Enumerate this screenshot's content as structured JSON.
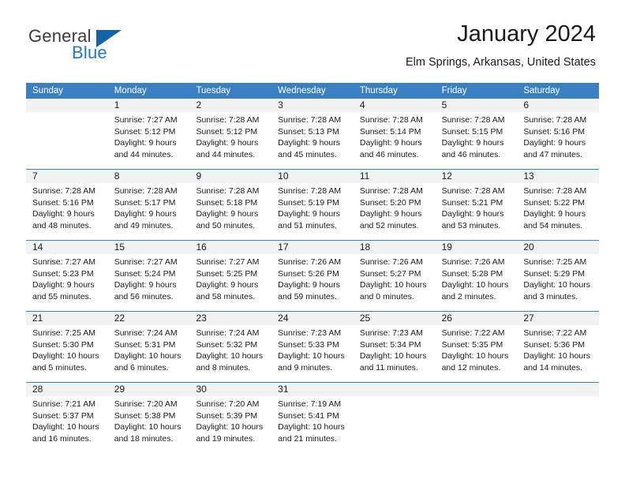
{
  "brand": {
    "name_top": "General",
    "name_bottom": "Blue",
    "color_top": "#3b3b3b",
    "color_bottom": "#1f7ac0",
    "triangle_color": "#1464a5"
  },
  "header": {
    "title": "January 2024",
    "subtitle": "Elm Springs, Arkansas, United States"
  },
  "theme": {
    "header_bg": "#3a80c1",
    "header_text": "#ffffff",
    "daynum_bg": "#f2f2f2",
    "row_divider": "#3a80c1",
    "body_text": "#1a1a1a"
  },
  "weekdays": [
    "Sunday",
    "Monday",
    "Tuesday",
    "Wednesday",
    "Thursday",
    "Friday",
    "Saturday"
  ],
  "weeks": [
    [
      {
        "day": "",
        "lines": [
          "",
          "",
          "",
          ""
        ]
      },
      {
        "day": "1",
        "lines": [
          "Sunrise: 7:27 AM",
          "Sunset: 5:12 PM",
          "Daylight: 9 hours",
          "and 44 minutes."
        ]
      },
      {
        "day": "2",
        "lines": [
          "Sunrise: 7:28 AM",
          "Sunset: 5:12 PM",
          "Daylight: 9 hours",
          "and 44 minutes."
        ]
      },
      {
        "day": "3",
        "lines": [
          "Sunrise: 7:28 AM",
          "Sunset: 5:13 PM",
          "Daylight: 9 hours",
          "and 45 minutes."
        ]
      },
      {
        "day": "4",
        "lines": [
          "Sunrise: 7:28 AM",
          "Sunset: 5:14 PM",
          "Daylight: 9 hours",
          "and 46 minutes."
        ]
      },
      {
        "day": "5",
        "lines": [
          "Sunrise: 7:28 AM",
          "Sunset: 5:15 PM",
          "Daylight: 9 hours",
          "and 46 minutes."
        ]
      },
      {
        "day": "6",
        "lines": [
          "Sunrise: 7:28 AM",
          "Sunset: 5:16 PM",
          "Daylight: 9 hours",
          "and 47 minutes."
        ]
      }
    ],
    [
      {
        "day": "7",
        "lines": [
          "Sunrise: 7:28 AM",
          "Sunset: 5:16 PM",
          "Daylight: 9 hours",
          "and 48 minutes."
        ]
      },
      {
        "day": "8",
        "lines": [
          "Sunrise: 7:28 AM",
          "Sunset: 5:17 PM",
          "Daylight: 9 hours",
          "and 49 minutes."
        ]
      },
      {
        "day": "9",
        "lines": [
          "Sunrise: 7:28 AM",
          "Sunset: 5:18 PM",
          "Daylight: 9 hours",
          "and 50 minutes."
        ]
      },
      {
        "day": "10",
        "lines": [
          "Sunrise: 7:28 AM",
          "Sunset: 5:19 PM",
          "Daylight: 9 hours",
          "and 51 minutes."
        ]
      },
      {
        "day": "11",
        "lines": [
          "Sunrise: 7:28 AM",
          "Sunset: 5:20 PM",
          "Daylight: 9 hours",
          "and 52 minutes."
        ]
      },
      {
        "day": "12",
        "lines": [
          "Sunrise: 7:28 AM",
          "Sunset: 5:21 PM",
          "Daylight: 9 hours",
          "and 53 minutes."
        ]
      },
      {
        "day": "13",
        "lines": [
          "Sunrise: 7:28 AM",
          "Sunset: 5:22 PM",
          "Daylight: 9 hours",
          "and 54 minutes."
        ]
      }
    ],
    [
      {
        "day": "14",
        "lines": [
          "Sunrise: 7:27 AM",
          "Sunset: 5:23 PM",
          "Daylight: 9 hours",
          "and 55 minutes."
        ]
      },
      {
        "day": "15",
        "lines": [
          "Sunrise: 7:27 AM",
          "Sunset: 5:24 PM",
          "Daylight: 9 hours",
          "and 56 minutes."
        ]
      },
      {
        "day": "16",
        "lines": [
          "Sunrise: 7:27 AM",
          "Sunset: 5:25 PM",
          "Daylight: 9 hours",
          "and 58 minutes."
        ]
      },
      {
        "day": "17",
        "lines": [
          "Sunrise: 7:26 AM",
          "Sunset: 5:26 PM",
          "Daylight: 9 hours",
          "and 59 minutes."
        ]
      },
      {
        "day": "18",
        "lines": [
          "Sunrise: 7:26 AM",
          "Sunset: 5:27 PM",
          "Daylight: 10 hours",
          "and 0 minutes."
        ]
      },
      {
        "day": "19",
        "lines": [
          "Sunrise: 7:26 AM",
          "Sunset: 5:28 PM",
          "Daylight: 10 hours",
          "and 2 minutes."
        ]
      },
      {
        "day": "20",
        "lines": [
          "Sunrise: 7:25 AM",
          "Sunset: 5:29 PM",
          "Daylight: 10 hours",
          "and 3 minutes."
        ]
      }
    ],
    [
      {
        "day": "21",
        "lines": [
          "Sunrise: 7:25 AM",
          "Sunset: 5:30 PM",
          "Daylight: 10 hours",
          "and 5 minutes."
        ]
      },
      {
        "day": "22",
        "lines": [
          "Sunrise: 7:24 AM",
          "Sunset: 5:31 PM",
          "Daylight: 10 hours",
          "and 6 minutes."
        ]
      },
      {
        "day": "23",
        "lines": [
          "Sunrise: 7:24 AM",
          "Sunset: 5:32 PM",
          "Daylight: 10 hours",
          "and 8 minutes."
        ]
      },
      {
        "day": "24",
        "lines": [
          "Sunrise: 7:23 AM",
          "Sunset: 5:33 PM",
          "Daylight: 10 hours",
          "and 9 minutes."
        ]
      },
      {
        "day": "25",
        "lines": [
          "Sunrise: 7:23 AM",
          "Sunset: 5:34 PM",
          "Daylight: 10 hours",
          "and 11 minutes."
        ]
      },
      {
        "day": "26",
        "lines": [
          "Sunrise: 7:22 AM",
          "Sunset: 5:35 PM",
          "Daylight: 10 hours",
          "and 12 minutes."
        ]
      },
      {
        "day": "27",
        "lines": [
          "Sunrise: 7:22 AM",
          "Sunset: 5:36 PM",
          "Daylight: 10 hours",
          "and 14 minutes."
        ]
      }
    ],
    [
      {
        "day": "28",
        "lines": [
          "Sunrise: 7:21 AM",
          "Sunset: 5:37 PM",
          "Daylight: 10 hours",
          "and 16 minutes."
        ]
      },
      {
        "day": "29",
        "lines": [
          "Sunrise: 7:20 AM",
          "Sunset: 5:38 PM",
          "Daylight: 10 hours",
          "and 18 minutes."
        ]
      },
      {
        "day": "30",
        "lines": [
          "Sunrise: 7:20 AM",
          "Sunset: 5:39 PM",
          "Daylight: 10 hours",
          "and 19 minutes."
        ]
      },
      {
        "day": "31",
        "lines": [
          "Sunrise: 7:19 AM",
          "Sunset: 5:41 PM",
          "Daylight: 10 hours",
          "and 21 minutes."
        ]
      },
      {
        "day": "",
        "lines": [
          "",
          "",
          "",
          ""
        ]
      },
      {
        "day": "",
        "lines": [
          "",
          "",
          "",
          ""
        ]
      },
      {
        "day": "",
        "lines": [
          "",
          "",
          "",
          ""
        ]
      }
    ]
  ]
}
